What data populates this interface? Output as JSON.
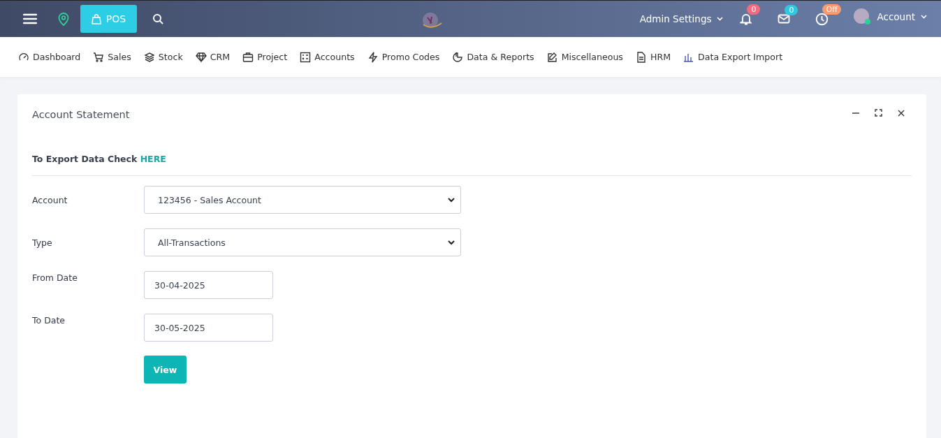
{
  "topbar": {
    "pos_label": "POS",
    "admin_settings": "Admin Settings",
    "indicators": [
      {
        "badge": "0",
        "color": "#f56b7d"
      },
      {
        "badge": "0",
        "color": "#2ec9e0"
      },
      {
        "badge": "Off",
        "color": "#fb9a6e"
      }
    ],
    "account": "Account"
  },
  "nav": [
    "Dashboard",
    "Sales",
    "Stock",
    "CRM",
    "Project",
    "Accounts",
    "Promo Codes",
    "Data & Reports",
    "Miscellaneous",
    "HRM",
    "Data Export Import"
  ],
  "card": {
    "title": "Account Statement",
    "export_note": "To Export Data Check",
    "export_link": "HERE",
    "fields": [
      {
        "label": "Account",
        "value": "123456 - Sales Account",
        "kind": "select"
      },
      {
        "label": "Type",
        "value": "All-Transactions",
        "kind": "select"
      },
      {
        "label": "From Date",
        "value": "30-04-2025",
        "kind": "date"
      },
      {
        "label": "To Date",
        "value": "30-05-2025",
        "kind": "date"
      }
    ],
    "button": "View"
  }
}
